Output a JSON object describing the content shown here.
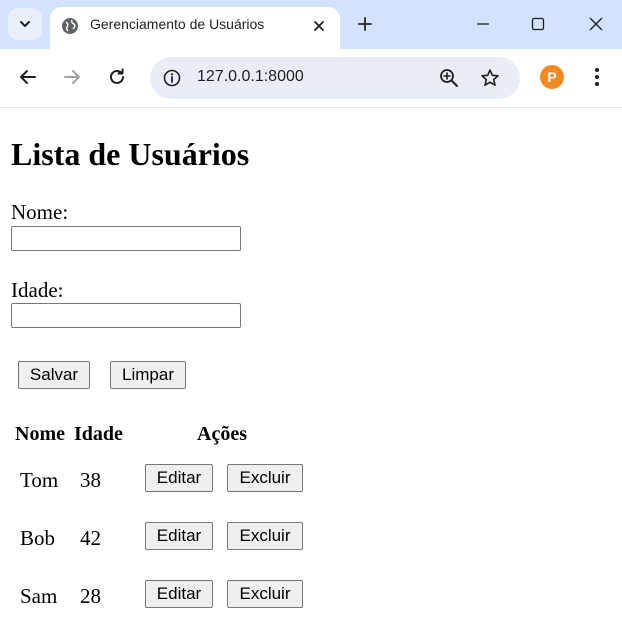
{
  "browser": {
    "tab": {
      "title": "Gerenciamento de Usuários"
    },
    "address_bar": {
      "url": "127.0.0.1:8000"
    },
    "profile_initial": "P"
  },
  "page": {
    "heading": "Lista de Usuários",
    "form": {
      "name_label": "Nome:",
      "name_value": "",
      "age_label": "Idade:",
      "age_value": "",
      "save_label": "Salvar",
      "clear_label": "Limpar"
    },
    "table": {
      "headers": [
        "Nome",
        "Idade",
        "Ações"
      ],
      "edit_label": "Editar",
      "delete_label": "Excluir",
      "rows": [
        {
          "name": "Tom",
          "age": "38"
        },
        {
          "name": "Bob",
          "age": "42"
        },
        {
          "name": "Sam",
          "age": "28"
        }
      ]
    }
  },
  "colors": {
    "tabstrip": "#d3e3fd",
    "omnibox": "#e9eef6",
    "button_face": "#efefef",
    "profile_avatar": "#f08a24"
  }
}
